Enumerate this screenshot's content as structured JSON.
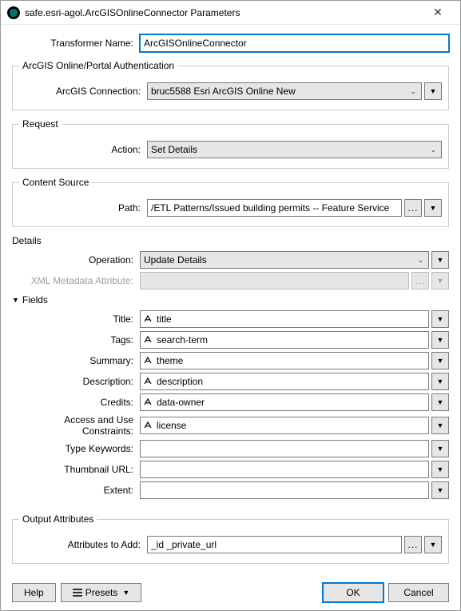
{
  "window": {
    "title": "safe.esri-agol.ArcGISOnlineConnector Parameters",
    "close_glyph": "✕"
  },
  "topRow": {
    "label": "Transformer Name:",
    "value": "ArcGISOnlineConnector"
  },
  "auth": {
    "legend": "ArcGIS Online/Portal Authentication",
    "connection_label": "ArcGIS Connection:",
    "connection_value": "bruc5588 Esri ArcGIS Online New"
  },
  "request": {
    "legend": "Request",
    "action_label": "Action:",
    "action_value": "Set Details"
  },
  "contentSource": {
    "legend": "Content Source",
    "path_label": "Path:",
    "path_value": "/ETL Patterns/Issued building permits -- Feature Service"
  },
  "details": {
    "legend": "Details",
    "operation_label": "Operation:",
    "operation_value": "Update Details",
    "xml_label": "XML Metadata Attribute:",
    "fields_legend": "Fields",
    "fields": {
      "title_label": "Title:",
      "title_value": "title",
      "tags_label": "Tags:",
      "tags_value": "search-term",
      "summary_label": "Summary:",
      "summary_value": "theme",
      "description_label": "Description:",
      "description_value": "description",
      "credits_label": "Credits:",
      "credits_value": "data-owner",
      "constraints_label": "Access and Use Constraints:",
      "constraints_value": "license",
      "keywords_label": "Type Keywords:",
      "keywords_value": "",
      "thumb_label": "Thumbnail URL:",
      "thumb_value": "",
      "extent_label": "Extent:",
      "extent_value": ""
    }
  },
  "output": {
    "legend": "Output Attributes",
    "attrs_label": "Attributes to Add:",
    "attrs_value": "_id _private_url"
  },
  "buttons": {
    "help": "Help",
    "presets": "Presets",
    "ok": "OK",
    "cancel": "Cancel"
  },
  "glyphs": {
    "ellipsis": "...",
    "down": "▼",
    "caret": "▼"
  }
}
